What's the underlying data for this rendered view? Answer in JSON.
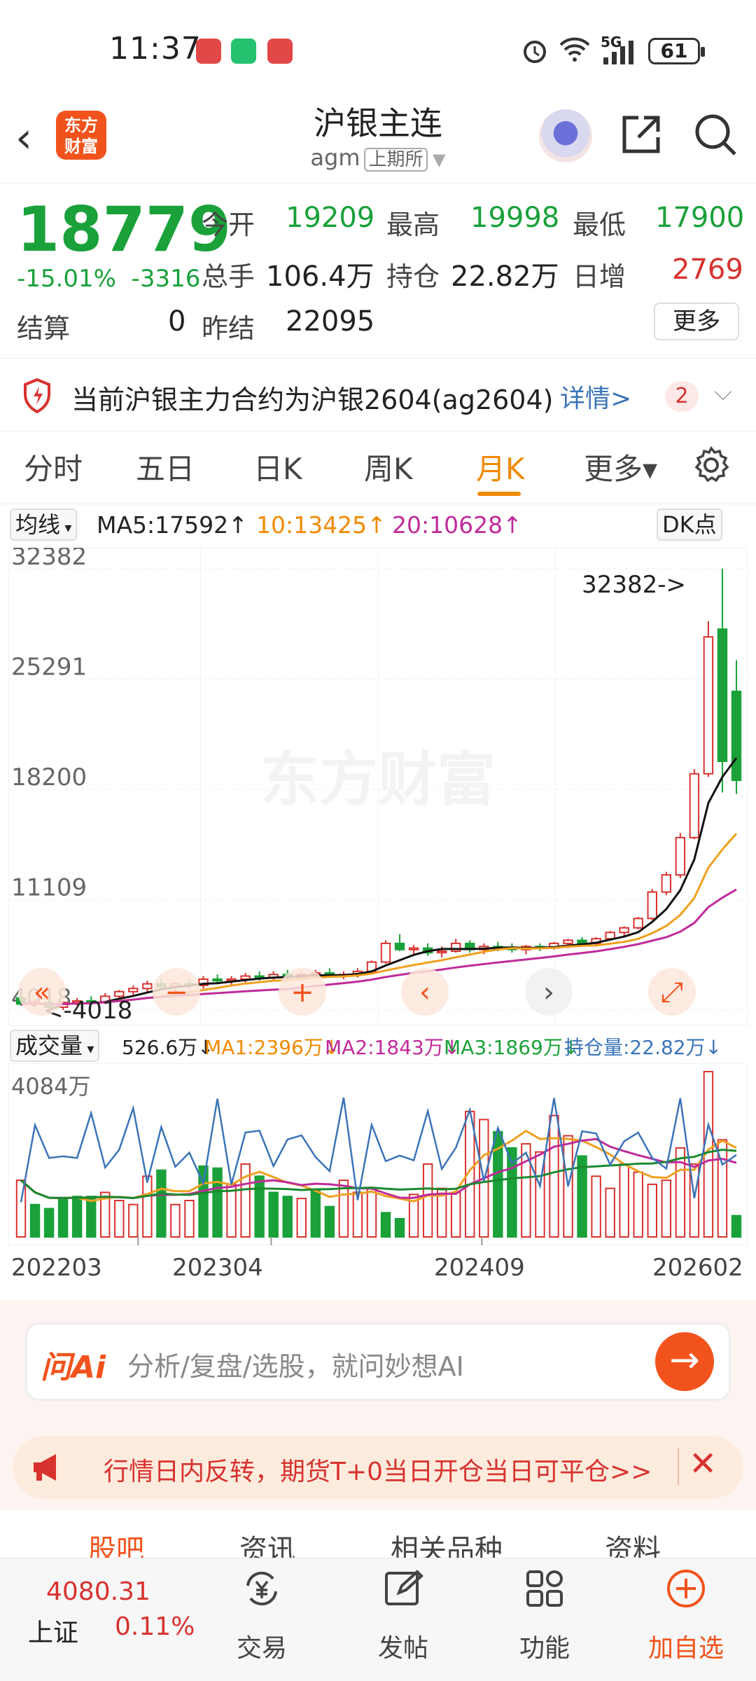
{
  "status": {
    "time": "11:37",
    "network": "5G",
    "battery": "61"
  },
  "header": {
    "title": "沪银主连",
    "code": "agm",
    "exchange": "上期所",
    "logo_line1": "东方",
    "logo_line2": "财富"
  },
  "quote": {
    "price": "18779",
    "change_pct": "-15.01%",
    "change": "-3316",
    "open_label": "今开",
    "open": "19209",
    "high_label": "最高",
    "high": "19998",
    "low_label": "最低",
    "low": "17900",
    "vol_label": "总手",
    "vol": "106.4万",
    "oi_label": "持仓",
    "oi": "22.82万",
    "daily_inc_label": "日增",
    "daily_inc": "2769",
    "settle_label": "结算",
    "settle": "0",
    "prev_settle_label": "昨结",
    "prev_settle": "22095",
    "more": "更多"
  },
  "notice": {
    "text": "当前沪银主力合约为沪银2604(ag2604)",
    "link": "详情>",
    "badge": "2"
  },
  "tabs": [
    "分时",
    "五日",
    "日K",
    "周K",
    "月K",
    "更多▾"
  ],
  "ma_row": {
    "select": "均线",
    "ma5": "MA5:17592↑",
    "ma10": "10:13425↑",
    "ma20": "20:10628↑",
    "dk": "DK点"
  },
  "kline": {
    "y_labels": [
      "32382",
      "25291",
      "18200",
      "11109",
      "4018"
    ],
    "max_note": "32382->",
    "min_note": "<-4018",
    "watermark": "东方财富"
  },
  "vol_row": {
    "select": "成交量",
    "v": "526.6万↓",
    "ma1": "MA1:2396万↓",
    "ma2": "MA2:1843万↓",
    "ma3": "MA3:1869万↓",
    "oi": "持仓量:22.82万↓",
    "max": "4084万"
  },
  "x_labels": [
    "202203",
    "202304",
    "202409",
    "202602"
  ],
  "chart_data": [
    {
      "type": "candlestick",
      "title": "",
      "ylim": [
        4018,
        32382
      ],
      "x_start": "202203",
      "x_end": "202602",
      "ohlc": [
        [
          4800,
          5000,
          4300,
          4400
        ],
        [
          4400,
          4700,
          4200,
          4500
        ],
        [
          4500,
          4700,
          4000,
          4200
        ],
        [
          4200,
          4600,
          4018,
          4500
        ],
        [
          4500,
          4800,
          4300,
          4600
        ],
        [
          4600,
          4900,
          4400,
          4500
        ],
        [
          4500,
          5100,
          4400,
          4900
        ],
        [
          4900,
          5300,
          4800,
          5200
        ],
        [
          5200,
          5600,
          5000,
          5400
        ],
        [
          5400,
          5900,
          5200,
          5700
        ],
        [
          5700,
          6000,
          5300,
          5500
        ],
        [
          5500,
          5800,
          5200,
          5700
        ],
        [
          5700,
          6000,
          5400,
          5600
        ],
        [
          5600,
          6200,
          5400,
          6000
        ],
        [
          6000,
          6300,
          5700,
          5900
        ],
        [
          5900,
          6200,
          5600,
          6000
        ],
        [
          6000,
          6400,
          5800,
          6200
        ],
        [
          6200,
          6500,
          5900,
          6100
        ],
        [
          6100,
          6500,
          5900,
          6300
        ],
        [
          6300,
          6600,
          6000,
          6100
        ],
        [
          6100,
          6500,
          5900,
          6300
        ],
        [
          6300,
          6600,
          6100,
          6400
        ],
        [
          6400,
          6700,
          6100,
          6200
        ],
        [
          6200,
          6500,
          6000,
          6300
        ],
        [
          6300,
          6700,
          6100,
          6500
        ],
        [
          6500,
          7200,
          6400,
          7100
        ],
        [
          7100,
          8500,
          7000,
          8300
        ],
        [
          8300,
          8900,
          7800,
          7900
        ],
        [
          7900,
          8200,
          7600,
          8000
        ],
        [
          8000,
          8300,
          7500,
          7700
        ],
        [
          7700,
          8100,
          7400,
          7800
        ],
        [
          7800,
          8600,
          7700,
          8300
        ],
        [
          8300,
          8500,
          7700,
          7900
        ],
        [
          7900,
          8300,
          7600,
          8100
        ],
        [
          8100,
          8400,
          7800,
          8000
        ],
        [
          8000,
          8300,
          7700,
          7900
        ],
        [
          7900,
          8200,
          7600,
          8100
        ],
        [
          8100,
          8300,
          7800,
          8000
        ],
        [
          8000,
          8400,
          7900,
          8300
        ],
        [
          8300,
          8600,
          8000,
          8500
        ],
        [
          8500,
          8700,
          8200,
          8300
        ],
        [
          8300,
          8700,
          8100,
          8600
        ],
        [
          8600,
          9100,
          8500,
          9000
        ],
        [
          9000,
          9400,
          8800,
          9300
        ],
        [
          9300,
          10000,
          9200,
          9900
        ],
        [
          9900,
          11800,
          9800,
          11600
        ],
        [
          11600,
          12900,
          11400,
          12700
        ],
        [
          12700,
          15400,
          12500,
          15100
        ],
        [
          15100,
          19500,
          15000,
          19200
        ],
        [
          19200,
          29000,
          19000,
          28000
        ],
        [
          28500,
          32382,
          18000,
          20000
        ],
        [
          24500,
          26500,
          17900,
          18779
        ]
      ],
      "ma5_last": 17592,
      "ma10_last": 13425,
      "ma20_last": 10628
    },
    {
      "type": "bar",
      "title": "",
      "ylim": [
        0,
        4084
      ],
      "unit": "万",
      "values": [
        1400,
        800,
        700,
        950,
        1000,
        1000,
        1100,
        900,
        800,
        1500,
        1650,
        800,
        900,
        1750,
        1700,
        1300,
        1800,
        1500,
        1100,
        1000,
        950,
        1150,
        750,
        1400,
        1100,
        1200,
        600,
        450,
        1050,
        1800,
        1200,
        1100,
        3100,
        2900,
        2600,
        2200,
        2300,
        2100,
        3000,
        2500,
        2000,
        1500,
        1200,
        1800,
        1600,
        1300,
        1400,
        2200,
        1800,
        4084,
        2400,
        526
      ],
      "up": [
        1,
        0,
        0,
        0,
        0,
        0,
        1,
        1,
        1,
        1,
        0,
        1,
        1,
        0,
        0,
        1,
        1,
        0,
        0,
        0,
        1,
        0,
        0,
        1,
        1,
        1,
        0,
        0,
        1,
        1,
        1,
        1,
        1,
        1,
        0,
        0,
        1,
        1,
        1,
        1,
        0,
        1,
        1,
        1,
        1,
        1,
        1,
        1,
        1,
        1,
        1,
        0
      ],
      "ma1_last": 2396,
      "ma2_last": 1843,
      "ma3_last": 1869
    }
  ],
  "ai": {
    "logo": "问Ai",
    "placeholder": "分析/复盘/选股，就问妙想AI"
  },
  "promo": {
    "text": "行情日内反转，期货T+0当日开仓当日可平仓>>"
  },
  "subtabs": [
    "股吧",
    "资讯",
    "相关品种",
    "资料"
  ],
  "bottom": {
    "index_value": "4080.31",
    "index_name": "上证",
    "index_pct": "0.11%",
    "trade": "交易",
    "post": "发帖",
    "func": "功能",
    "add": "加自选"
  },
  "colors": {
    "up": "#d8322f",
    "down": "#1aa13a",
    "ma5": "#111111",
    "ma10": "#f0a020",
    "ma20": "#c02b9a",
    "accent": "#f2531d"
  }
}
